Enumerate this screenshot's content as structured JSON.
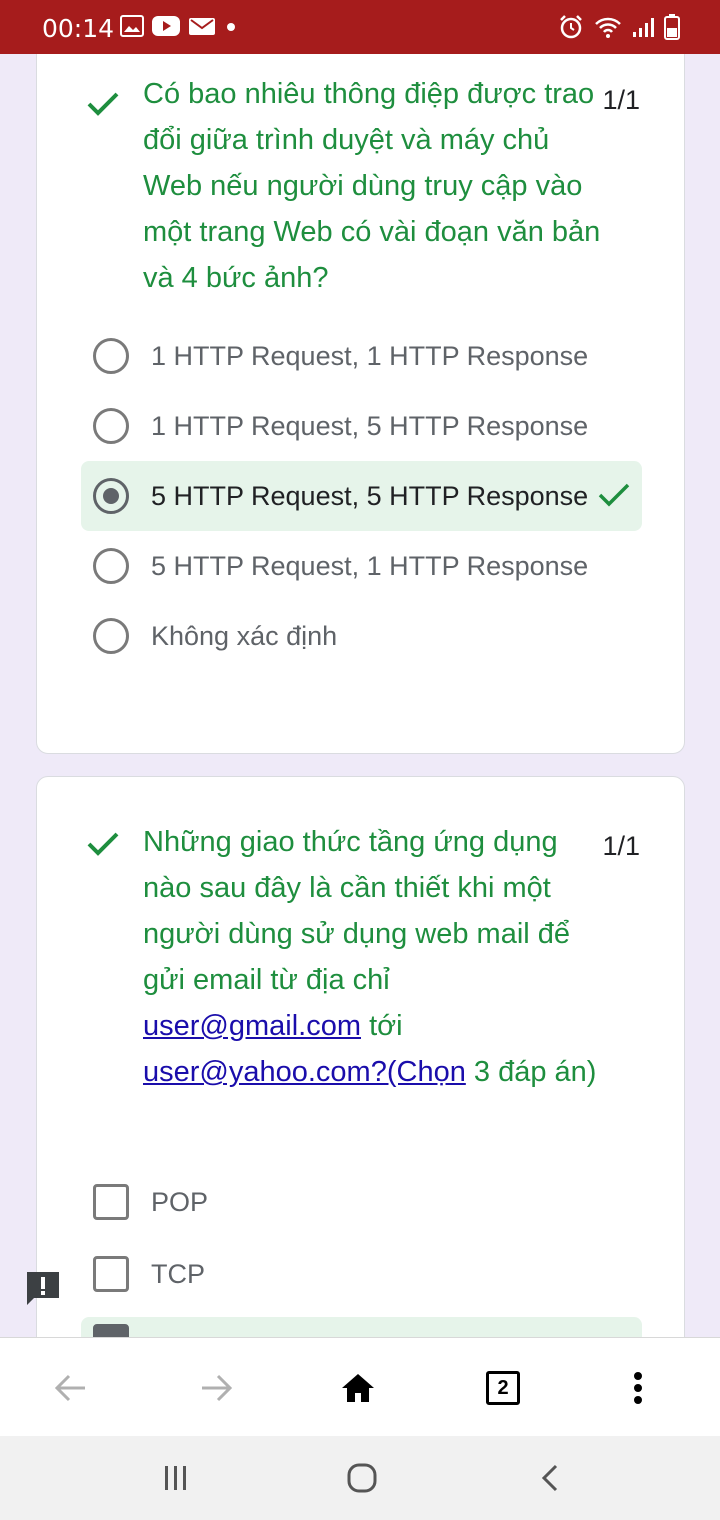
{
  "status_bar": {
    "time": "00:14",
    "icons_left": [
      "image-icon",
      "youtube-icon",
      "email-icon",
      "dot-icon"
    ],
    "icons_right": [
      "alarm-icon",
      "wifi-icon",
      "signal-icon",
      "battery-icon"
    ]
  },
  "colors": {
    "status_bar": "#a61c1c",
    "correct_text": "#1e8e3e",
    "correct_bg": "#e6f4ea",
    "link": "#1a0dab",
    "page_bg": "#efeaf8"
  },
  "questions": [
    {
      "text": "Có bao nhiêu thông điệp được trao đổi giữa trình duyệt và máy chủ Web nếu người dùng truy cập vào một trang Web có vài đoạn văn bản và 4 bức ảnh?",
      "score": "1/1",
      "options": [
        "1 HTTP Request, 1 HTTP Response",
        "1 HTTP Request, 5 HTTP Response",
        "5 HTTP Request, 5 HTTP Response",
        "5 HTTP Request, 1 HTTP Response",
        "Không xác định"
      ],
      "selected_index": 2
    },
    {
      "text_before": "Những giao thức tầng ứng dụng nào sau đây là cần thiết khi một người dùng sử dụng web mail để gửi email từ địa chỉ",
      "link1": "user@gmail.com",
      "text_mid": "tới",
      "link2": "user@yahoo.com?(Chọn",
      "text_after": "3 đáp án)",
      "score": "1/1",
      "options": [
        "POP",
        "TCP"
      ]
    }
  ],
  "browser_bar": {
    "tab_count": "2"
  }
}
